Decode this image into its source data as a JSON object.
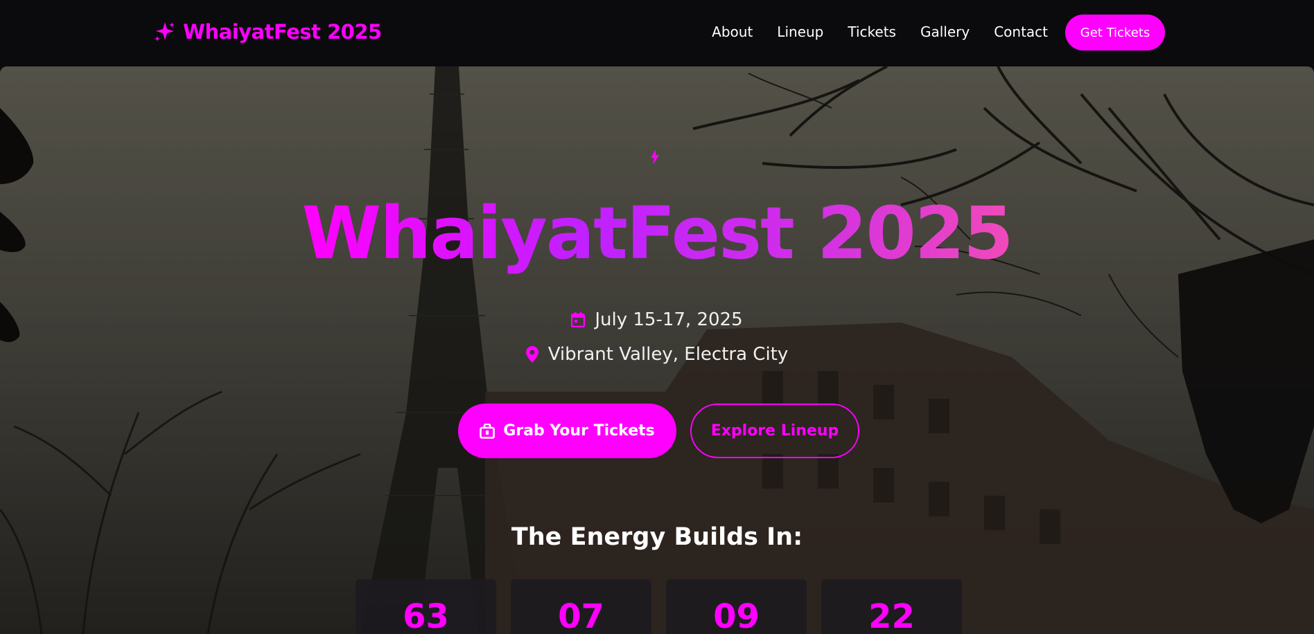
{
  "navbar": {
    "brand": "WhaiyatFest 2025",
    "links": [
      "About",
      "Lineup",
      "Tickets",
      "Gallery",
      "Contact"
    ],
    "cta": "Get Tickets"
  },
  "hero": {
    "title": "WhaiyatFest 2025",
    "date": "July 15-17, 2025",
    "location": "Vibrant Valley, Electra City",
    "primary_button": "Grab Your Tickets",
    "secondary_button": "Explore Lineup",
    "countdown_heading": "The Energy Builds In:",
    "countdown": [
      "63",
      "07",
      "09",
      "22"
    ]
  },
  "colors": {
    "accent": "#ff00ff",
    "nav_bg": "#0b0a0d",
    "text": "#ffffff"
  },
  "icons": {
    "brand": "sparkle-icon",
    "hero_top": "bolt-icon",
    "date": "calendar-icon",
    "location": "map-pin-icon",
    "primary_button": "ticket-bag-icon"
  }
}
